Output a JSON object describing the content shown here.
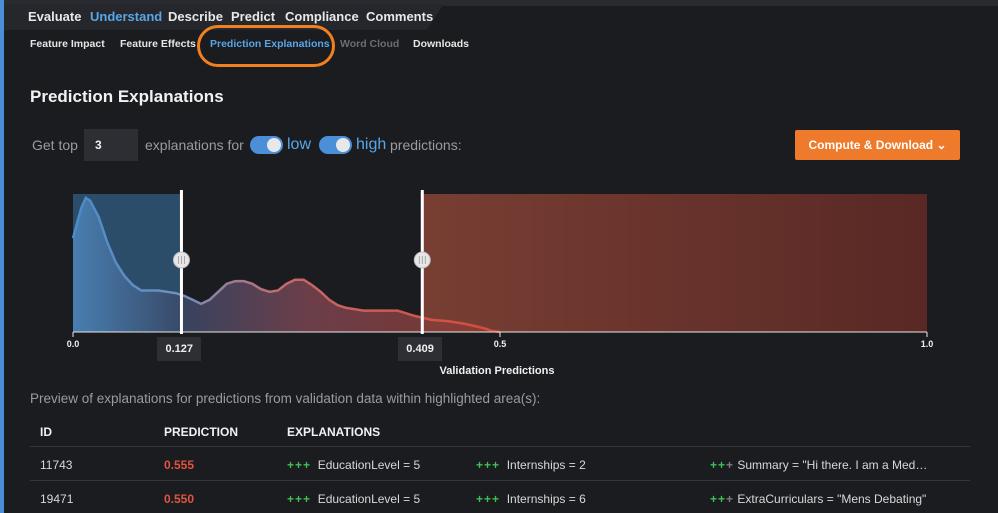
{
  "nav": {
    "top": [
      "Evaluate",
      "Understand",
      "Describe",
      "Predict",
      "Compliance",
      "Comments"
    ],
    "sub": [
      "Feature Impact",
      "Feature Effects",
      "Prediction Explanations",
      "Word Cloud",
      "Downloads"
    ]
  },
  "page_title": "Prediction Explanations",
  "controls": {
    "get_top": "Get top",
    "count": "3",
    "explanations_for": "explanations for",
    "low": "low",
    "high": "high",
    "predictions": "predictions:",
    "compute_button": "Compute & Download"
  },
  "chart_data": {
    "type": "area",
    "xlabel": "Validation Predictions",
    "xlim": [
      0,
      1
    ],
    "x_ticks": [
      "0.0",
      "0.5",
      "1.0"
    ],
    "low_threshold": "0.127",
    "high_threshold": "0.409",
    "distribution": {
      "x": [
        0.0,
        0.005,
        0.01,
        0.015,
        0.02,
        0.03,
        0.04,
        0.05,
        0.06,
        0.07,
        0.08,
        0.09,
        0.1,
        0.11,
        0.12,
        0.13,
        0.14,
        0.15,
        0.16,
        0.17,
        0.18,
        0.19,
        0.2,
        0.21,
        0.22,
        0.23,
        0.24,
        0.25,
        0.26,
        0.27,
        0.28,
        0.29,
        0.3,
        0.31,
        0.32,
        0.33,
        0.34,
        0.35,
        0.36,
        0.38,
        0.4,
        0.42,
        0.44,
        0.46,
        0.48,
        0.49,
        0.5
      ],
      "y": [
        0.7,
        0.82,
        0.93,
        1.0,
        0.98,
        0.86,
        0.67,
        0.52,
        0.42,
        0.35,
        0.31,
        0.31,
        0.31,
        0.3,
        0.29,
        0.27,
        0.24,
        0.21,
        0.24,
        0.3,
        0.36,
        0.38,
        0.38,
        0.36,
        0.32,
        0.3,
        0.31,
        0.36,
        0.39,
        0.39,
        0.35,
        0.3,
        0.24,
        0.2,
        0.18,
        0.17,
        0.16,
        0.16,
        0.16,
        0.16,
        0.12,
        0.09,
        0.08,
        0.06,
        0.03,
        0.01,
        0.0
      ]
    }
  },
  "preview_text": "Preview of explanations for predictions from validation data within highlighted area(s):",
  "table": {
    "headers": [
      "ID",
      "PREDICTION",
      "EXPLANATIONS"
    ],
    "rows": [
      {
        "id": "11743",
        "prediction": "0.555",
        "explanations": [
          {
            "strength": "+++",
            "dim": "",
            "text": "EducationLevel = 5"
          },
          {
            "strength": "+++",
            "dim": "",
            "text": "Internships = 2"
          },
          {
            "strength": "++",
            "dim": "+",
            "text": "Summary = \"Hi there. I am a Med…"
          }
        ]
      },
      {
        "id": "19471",
        "prediction": "0.550",
        "explanations": [
          {
            "strength": "+++",
            "dim": "",
            "text": "EducationLevel = 5"
          },
          {
            "strength": "+++",
            "dim": "",
            "text": "Internships = 6"
          },
          {
            "strength": "++",
            "dim": "+",
            "text": "ExtraCurriculars = \"Mens Debating\""
          }
        ]
      }
    ]
  },
  "colors": {
    "accent_blue": "#58a6e8",
    "orange": "#ee7a2b",
    "low_region": "#3f6e97",
    "high_region": "#7a3a32",
    "positive": "#3fbf55",
    "prediction": "#e2543e"
  }
}
